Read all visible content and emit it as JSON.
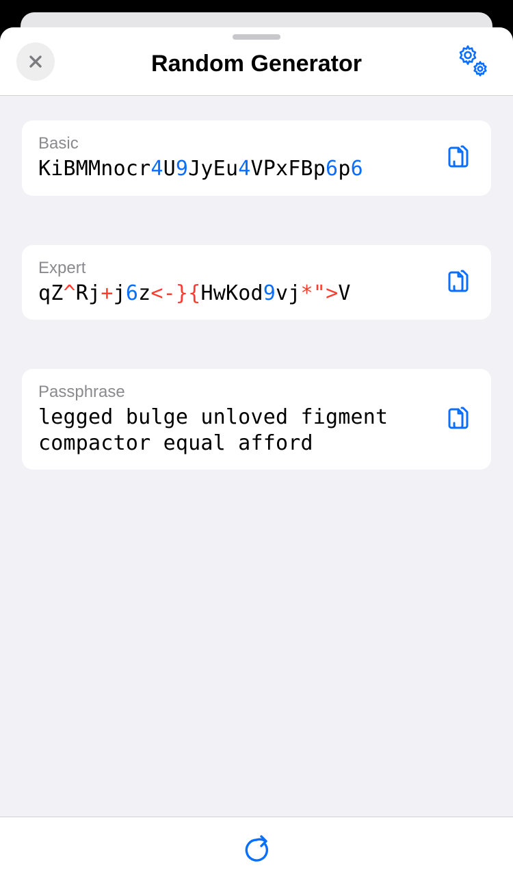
{
  "header": {
    "title": "Random Generator"
  },
  "colors": {
    "accent": "#0a6fff",
    "digit": "#0a6fff",
    "symbol": "#ff3b30",
    "label": "#8a8a8e"
  },
  "cards": [
    {
      "label": "Basic",
      "segments": [
        {
          "t": "KiBMMnocr",
          "k": "n"
        },
        {
          "t": "4",
          "k": "d"
        },
        {
          "t": "U",
          "k": "n"
        },
        {
          "t": "9",
          "k": "d"
        },
        {
          "t": "JyEu",
          "k": "n"
        },
        {
          "t": "4",
          "k": "d"
        },
        {
          "t": "VPxFBp",
          "k": "n"
        },
        {
          "t": "6",
          "k": "d"
        },
        {
          "t": "p",
          "k": "n"
        },
        {
          "t": "6",
          "k": "d"
        }
      ]
    },
    {
      "label": "Expert",
      "segments": [
        {
          "t": "qZ",
          "k": "n"
        },
        {
          "t": "^",
          "k": "s"
        },
        {
          "t": "Rj",
          "k": "n"
        },
        {
          "t": "+",
          "k": "s"
        },
        {
          "t": "j",
          "k": "n"
        },
        {
          "t": "6",
          "k": "d"
        },
        {
          "t": "z",
          "k": "n"
        },
        {
          "t": "<-}{",
          "k": "s"
        },
        {
          "t": "HwKod",
          "k": "n"
        },
        {
          "t": "9",
          "k": "d"
        },
        {
          "t": "vj",
          "k": "n"
        },
        {
          "t": "*\">",
          "k": "s"
        },
        {
          "t": "V",
          "k": "n"
        }
      ]
    },
    {
      "label": "Passphrase",
      "segments": [
        {
          "t": "legged bulge unloved figment compactor equal afford",
          "k": "n"
        }
      ]
    }
  ]
}
